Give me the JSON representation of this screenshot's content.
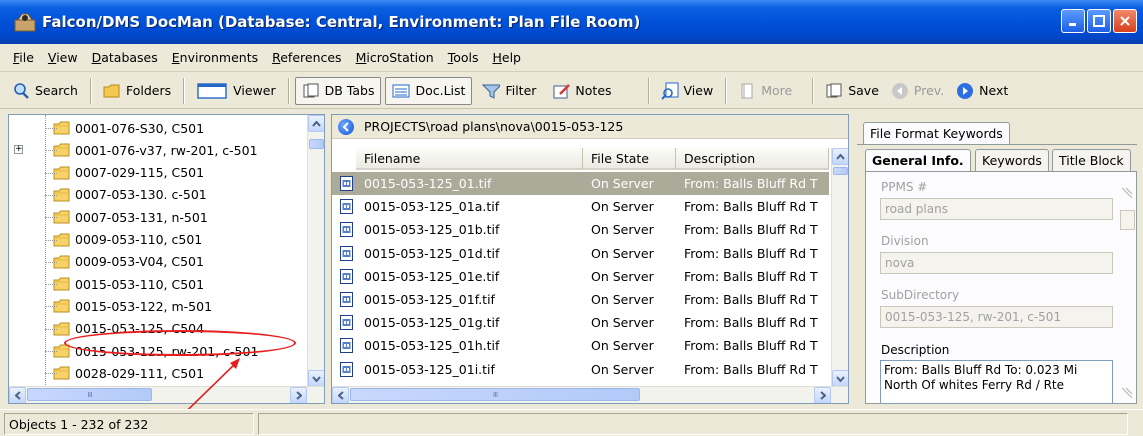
{
  "window": {
    "title": "Falcon/DMS DocMan (Database: Central, Environment: Plan File Room)"
  },
  "menu": [
    {
      "key": "file",
      "accel": "F",
      "rest": "ile"
    },
    {
      "key": "view",
      "accel": "V",
      "rest": "iew"
    },
    {
      "key": "databases",
      "accel": "D",
      "rest": "atabases"
    },
    {
      "key": "environments",
      "accel": "E",
      "rest": "nvironments"
    },
    {
      "key": "references",
      "accel": "R",
      "rest": "eferences"
    },
    {
      "key": "microstation",
      "accel": "M",
      "rest": "icroStation"
    },
    {
      "key": "tools",
      "accel": "T",
      "rest": "ools"
    },
    {
      "key": "help",
      "accel": "H",
      "rest": "elp"
    }
  ],
  "toolbar": {
    "search": "Search",
    "folders": "Folders",
    "viewer": "Viewer",
    "db_tabs": "DB Tabs",
    "doc_list": "Doc.List",
    "filter": "Filter",
    "notes": "Notes",
    "view": "View",
    "more": "More",
    "save": "Save",
    "prev": "Prev.",
    "next": "Next"
  },
  "tree": {
    "items": [
      {
        "label": "0001-076-S30, C501",
        "expander": ""
      },
      {
        "label": "0001-076-v37, rw-201, c-501",
        "expander": "+"
      },
      {
        "label": "0007-029-115, C501",
        "expander": ""
      },
      {
        "label": "0007-053-130. c-501",
        "expander": ""
      },
      {
        "label": "0007-053-131, n-501",
        "expander": ""
      },
      {
        "label": "0009-053-110, c501",
        "expander": ""
      },
      {
        "label": "0009-053-V04, C501",
        "expander": ""
      },
      {
        "label": "0015-053-110, C501",
        "expander": ""
      },
      {
        "label": "0015-053-122, m-501",
        "expander": ""
      },
      {
        "label": "0015-053-125, C504",
        "expander": ""
      },
      {
        "label": "0015-053-125, rw-201, c-501",
        "expander": ""
      },
      {
        "label": "0028-029-111, C501",
        "expander": ""
      }
    ]
  },
  "filelist": {
    "path": "PROJECTS\\road plans\\nova\\0015-053-125",
    "columns": [
      "Filename",
      "File State",
      "Description"
    ],
    "rows": [
      {
        "filename": "0015-053-125_01.tif",
        "state": "On Server",
        "desc": "From: Balls Bluff Rd T"
      },
      {
        "filename": "0015-053-125_01a.tif",
        "state": "On Server",
        "desc": "From: Balls Bluff Rd T"
      },
      {
        "filename": "0015-053-125_01b.tif",
        "state": "On Server",
        "desc": "From: Balls Bluff Rd T"
      },
      {
        "filename": "0015-053-125_01d.tif",
        "state": "On Server",
        "desc": "From: Balls Bluff Rd T"
      },
      {
        "filename": "0015-053-125_01e.tif",
        "state": "On Server",
        "desc": "From: Balls Bluff Rd T"
      },
      {
        "filename": "0015-053-125_01f.tif",
        "state": "On Server",
        "desc": "From: Balls Bluff Rd T"
      },
      {
        "filename": "0015-053-125_01g.tif",
        "state": "On Server",
        "desc": "From: Balls Bluff Rd T"
      },
      {
        "filename": "0015-053-125_01h.tif",
        "state": "On Server",
        "desc": "From: Balls Bluff Rd T"
      },
      {
        "filename": "0015-053-125_01i.tif",
        "state": "On Server",
        "desc": "From: Balls Bluff Rd T"
      }
    ]
  },
  "right": {
    "outer_tab": "File Format Keywords",
    "tabs": [
      "General Info.",
      "Keywords",
      "Title Block"
    ],
    "fields": {
      "ppms_label": "PPMS #",
      "ppms_value": "road plans",
      "division_label": "Division",
      "division_value": "nova",
      "subdir_label": "SubDirectory",
      "subdir_value": "0015-053-125, rw-201, c-501",
      "description_label": "Description",
      "description_value": "From: Balls Bluff Rd To: 0.023 Mi North Of whites Ferry Rd / Rte"
    }
  },
  "status": {
    "objects": "Objects 1 - 232 of 232"
  },
  "colors": {
    "title_bar": "#0050d8",
    "selection": "#acaa99",
    "annotation": "#e61e1e"
  }
}
